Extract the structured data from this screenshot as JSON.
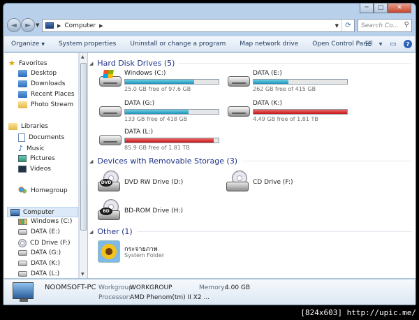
{
  "window": {
    "minimize": "─",
    "maximize": "□",
    "close": "✕"
  },
  "nav": {
    "back": "◄",
    "forward": "►",
    "address": "Computer",
    "search_placeholder": "Search Co..."
  },
  "toolbar": {
    "organize": "Organize",
    "system_properties": "System properties",
    "uninstall": "Uninstall or change a program",
    "map_drive": "Map network drive",
    "control_panel": "Open Control Panel",
    "help": "?"
  },
  "sidebar": {
    "favorites": "Favorites",
    "desktop": "Desktop",
    "downloads": "Downloads",
    "recent_places": "Recent Places",
    "photo_stream": "Photo Stream",
    "libraries": "Libraries",
    "documents": "Documents",
    "music": "Music",
    "pictures": "Pictures",
    "videos": "Videos",
    "homegroup": "Homegroup",
    "computer": "Computer",
    "windows_c": "Windows (C:)",
    "data_e": "DATA (E:)",
    "cd_f": "CD Drive (F:)",
    "data_g": "DATA (G:)",
    "data_k": "DATA (K:)",
    "data_l": "DATA (L:)"
  },
  "groups": {
    "hdd": "Hard Disk Drives (5)",
    "removable": "Devices with Removable Storage (3)",
    "other": "Other (1)"
  },
  "drives": [
    {
      "name": "Windows (C:)",
      "free": "25.0 GB free of 97.6 GB",
      "used_fraction": 0.74,
      "low": false
    },
    {
      "name": "DATA (E:)",
      "free": "262 GB free of 415 GB",
      "used_fraction": 0.37,
      "low": false
    },
    {
      "name": "DATA (G:)",
      "free": "133 GB free of 418 GB",
      "used_fraction": 0.68,
      "low": false
    },
    {
      "name": "DATA (K:)",
      "free": "4.49 GB free of 1.81 TB",
      "used_fraction": 0.998,
      "low": true
    },
    {
      "name": "DATA (L:)",
      "free": "85.9 GB free of 1.81 TB",
      "used_fraction": 0.95,
      "low": true
    }
  ],
  "removable": {
    "dvd": "DVD RW Drive (D:)",
    "cd": "CD Drive (F:)",
    "bd": "BD-ROM Drive (H:)",
    "dvd_badge": "DVD",
    "bd_badge": "BD"
  },
  "other": {
    "name": "กระจายภาพ",
    "sub": "System Folder"
  },
  "details": {
    "pc_name": "NOOMSOFT-PC",
    "workgroup_label": "Workgroup:",
    "workgroup": "WORKGROUP",
    "memory_label": "Memory:",
    "memory": "4.00 GB",
    "processor_label": "Processor:",
    "processor": "AMD Phenom(tm) II X2 ..."
  },
  "watermark": "[824x603] http://upic.me/"
}
